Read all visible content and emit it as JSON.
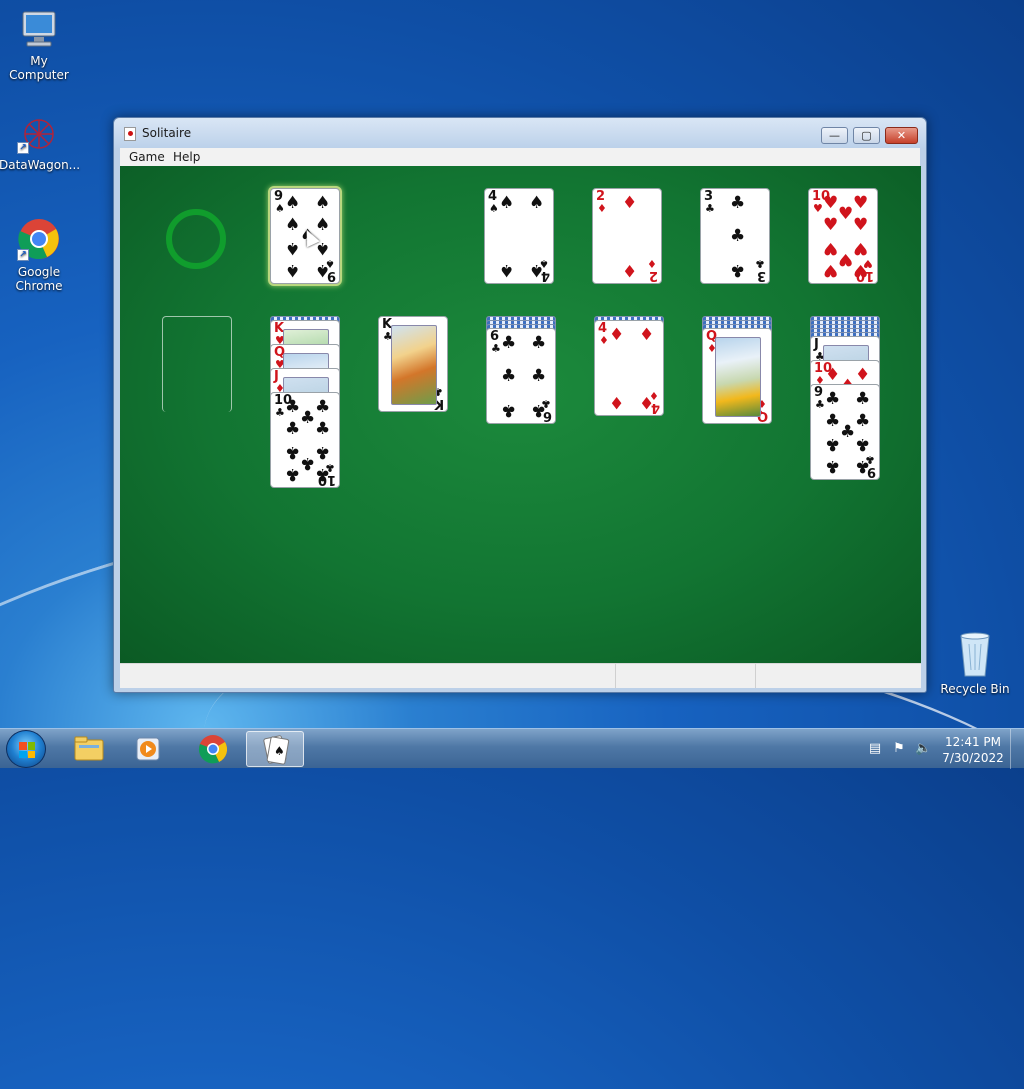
{
  "desktop": {
    "icons": [
      {
        "label": "My Computer",
        "icon": "my-computer-icon"
      },
      {
        "label": "DataWagon...",
        "icon": "datawagon-icon"
      },
      {
        "label": "Google Chrome",
        "icon": "chrome-icon"
      },
      {
        "label": "Recycle Bin",
        "icon": "recycle-bin-icon"
      }
    ]
  },
  "window": {
    "title": "Solitaire",
    "menu": [
      "Game",
      "Help"
    ],
    "controls": {
      "minimize": "—",
      "maximize": "▢",
      "close": "✕"
    }
  },
  "game": {
    "waste": {
      "rank": "9",
      "suit": "♠",
      "color": "black",
      "highlighted": true
    },
    "foundations": [
      {
        "rank": "4",
        "suit": "♠",
        "color": "black"
      },
      {
        "rank": "2",
        "suit": "♦",
        "color": "red"
      },
      {
        "rank": "3",
        "suit": "♣",
        "color": "black"
      },
      {
        "rank": "10",
        "suit": "♥",
        "color": "red"
      }
    ],
    "tableau": [
      {
        "cards": [],
        "empty": true
      },
      {
        "hidden": 1,
        "cards": [
          {
            "rank": "K",
            "suit": "♥",
            "color": "red",
            "face": "king"
          },
          {
            "rank": "Q",
            "suit": "♥",
            "color": "red",
            "face": "queen"
          },
          {
            "rank": "J",
            "suit": "♦",
            "color": "red",
            "face": "jack"
          },
          {
            "rank": "10",
            "suit": "♣",
            "color": "black"
          }
        ]
      },
      {
        "hidden": 0,
        "cards": [
          {
            "rank": "K",
            "suit": "♣",
            "color": "black",
            "face": "king-art"
          }
        ]
      },
      {
        "hidden": 3,
        "cards": [
          {
            "rank": "6",
            "suit": "♣",
            "color": "black"
          }
        ]
      },
      {
        "hidden": 1,
        "cards": [
          {
            "rank": "4",
            "suit": "♦",
            "color": "red"
          }
        ]
      },
      {
        "hidden": 3,
        "cards": [
          {
            "rank": "Q",
            "suit": "♦",
            "color": "red",
            "face": "queen"
          }
        ]
      },
      {
        "hidden": 5,
        "cards": [
          {
            "rank": "J",
            "suit": "♣",
            "color": "black",
            "face": "jack"
          },
          {
            "rank": "10",
            "suit": "♦",
            "color": "red"
          },
          {
            "rank": "9",
            "suit": "♣",
            "color": "black"
          }
        ]
      }
    ]
  },
  "taskbar": {
    "items": [
      "start-button",
      "file-explorer-icon",
      "media-player-icon",
      "chrome-icon",
      "solitaire-icon"
    ],
    "time": "12:41 PM",
    "date": "7/30/2022"
  }
}
